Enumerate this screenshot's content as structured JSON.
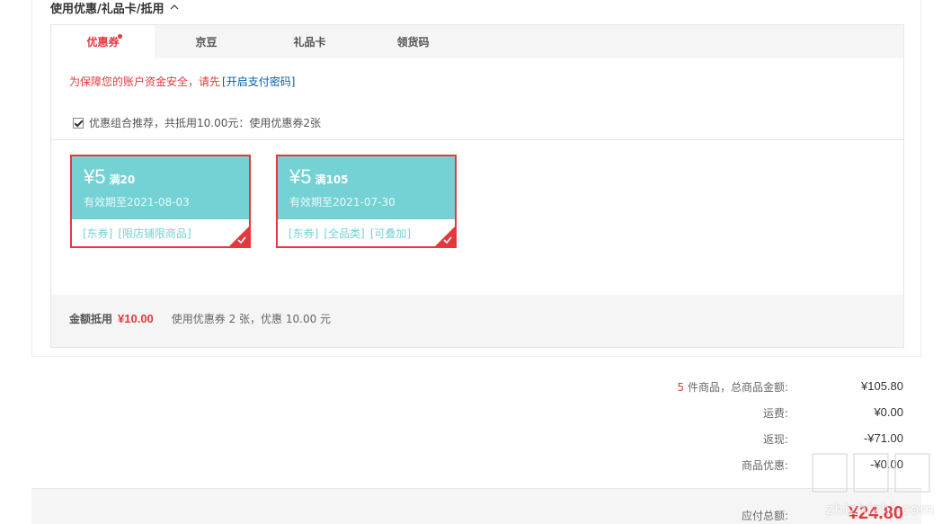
{
  "section": {
    "title": "使用优惠/礼品卡/抵用"
  },
  "tabs": [
    {
      "label": "优惠券",
      "active": true
    },
    {
      "label": "京豆",
      "active": false
    },
    {
      "label": "礼品卡",
      "active": false
    },
    {
      "label": "领货码",
      "active": false
    }
  ],
  "warning": {
    "text": "为保障您的账户资金安全，请先",
    "link": "[开启支付密码]"
  },
  "combo": {
    "text": "优惠组合推荐，共抵用10.00元：使用优惠券2张",
    "checked": true
  },
  "coupons": [
    {
      "amount": "¥5",
      "condition": "满20",
      "expiry": "有效期至2021-08-03",
      "tags": [
        "[东券]",
        "[限店铺限商品]"
      ]
    },
    {
      "amount": "¥5",
      "condition": "满105",
      "expiry": "有效期至2021-07-30",
      "tags": [
        "[东券]",
        "[全品类]",
        "[可叠加]"
      ]
    }
  ],
  "summary": {
    "label": "金额抵用",
    "value": "¥10.00",
    "desc": "使用优惠券 2 张，优惠 10.00 元"
  },
  "totals": {
    "count": "5",
    "goods_label": "件商品，总商品金额:",
    "goods_value": "¥105.80",
    "shipping_label": "运费:",
    "shipping_value": "¥0.00",
    "cashback_label": "返现:",
    "cashback_value": "-¥71.00",
    "discount_label": "商品优惠:",
    "discount_value": "-¥0.00",
    "pay_label": "应付总额:",
    "pay_value": "¥24.80"
  },
  "watermark": {
    "text": "zhizhizhi.com"
  },
  "colors": {
    "accent": "#e4393c",
    "coupon": "#74d2d4",
    "link": "#005ea7"
  }
}
